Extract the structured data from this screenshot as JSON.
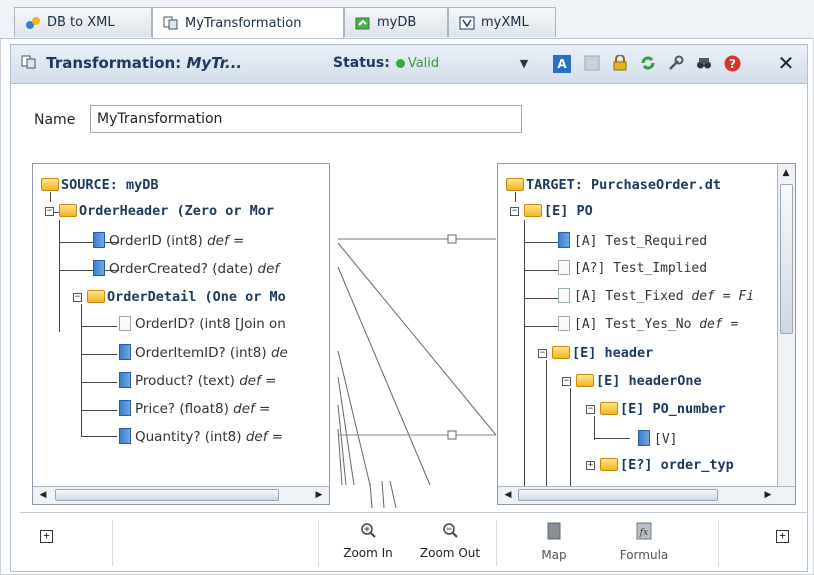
{
  "tabs": [
    {
      "label": "DB to XML",
      "icon": "db-xml-icon"
    },
    {
      "label": "MyTransformation",
      "icon": "transformation-icon"
    },
    {
      "label": "myDB",
      "icon": "database-icon"
    },
    {
      "label": "myXML",
      "icon": "xml-icon"
    }
  ],
  "header": {
    "title_prefix": "Transformation:",
    "title_name": "MyTr...",
    "status_label": "Status:",
    "status_value": "Valid",
    "toolbar": [
      "dropdown-icon",
      "text-icon",
      "save-icon",
      "lock-icon",
      "refresh-icon",
      "tools-icon",
      "find-icon",
      "help-icon",
      "close-icon"
    ]
  },
  "name_field": {
    "label": "Name",
    "value": "MyTransformation"
  },
  "source": {
    "root": "SOURCE: myDB",
    "order_header": "OrderHeader (Zero or Mor",
    "order_id": "OrderID (int8)",
    "order_id_def": "def =",
    "order_created": "OrderCreated? (date)",
    "order_created_def": "def",
    "order_detail": "OrderDetail (One or Mo",
    "od_order_id": "OrderID? (int8 [Join on",
    "order_item_id": "OrderItemID? (int8)",
    "order_item_id_def": "de",
    "product": "Product? (text)",
    "product_def": "def =",
    "price": "Price? (float8)",
    "price_def": "def =",
    "quantity": "Quantity? (int8)",
    "quantity_def": "def ="
  },
  "target": {
    "root": "TARGET: PurchaseOrder.dt",
    "po": "[E] PO",
    "test_required": "[A] Test_Required",
    "test_implied": "[A?] Test_Implied",
    "test_fixed": "[A] Test_Fixed",
    "test_fixed_def": "def = Fi",
    "test_yes_no": "[A] Test_Yes_No",
    "test_yes_no_def": "def =",
    "header": "[E] header",
    "header_one": "[E] headerOne",
    "po_number": "[E] PO_number",
    "value": "[V]",
    "order_type": "[E?] order_typ"
  },
  "footer": {
    "zoom_in": "Zoom In",
    "zoom_out": "Zoom Out",
    "map": "Map",
    "formula": "Formula",
    "fx": "fx"
  },
  "colors": {
    "accent": "#1d3960",
    "valid": "#3a9a3a",
    "folder": "#f2b521",
    "column": "#3a7fd0"
  }
}
